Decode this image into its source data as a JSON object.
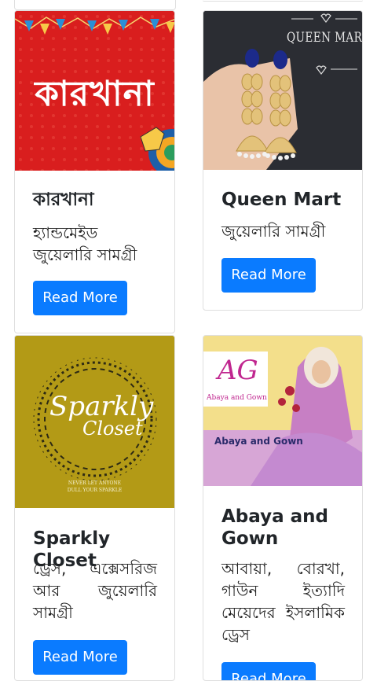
{
  "colors": {
    "button": "#0a7bff",
    "karkhana_bg": "#d91e1e",
    "sparkly_bg": "#b39a16",
    "queen_bg": "#2b2d33",
    "abaya_bg": "#f3df8b"
  },
  "cards": [
    {
      "title": "কারখানা",
      "description": "হ্যান্ডমেইড জুয়েলারি সামগ্রী",
      "button_label": "Read More",
      "image": {
        "logo_text": "কারখানা"
      }
    },
    {
      "title": "Queen Mart",
      "description": "জুয়েলারি সামগ্রী",
      "button_label": "Read More",
      "image": {
        "logo_text": "QUEEN MART"
      }
    },
    {
      "title": "Sparkly Closet",
      "description": "ড্রেস, এক্সেসরিজ আর জুয়েলারি সামগ্রী",
      "button_label": "Read More",
      "image": {
        "logo_line1": "Sparkly",
        "logo_line2": "Closet",
        "tagline1": "NEVER LET ANYONE",
        "tagline2": "DULL YOUR SPARKLE"
      }
    },
    {
      "title": "Abaya and Gown",
      "description": "আবায়া, বোরখা, গাউন ইত্যাদি মেয়েদের ইসলামিক ড্রেস",
      "button_label": "Read More",
      "image": {
        "logo_letters": "AG",
        "logo_caption": "Abaya and Gown",
        "banner_text": "Abaya and Gown"
      }
    }
  ]
}
